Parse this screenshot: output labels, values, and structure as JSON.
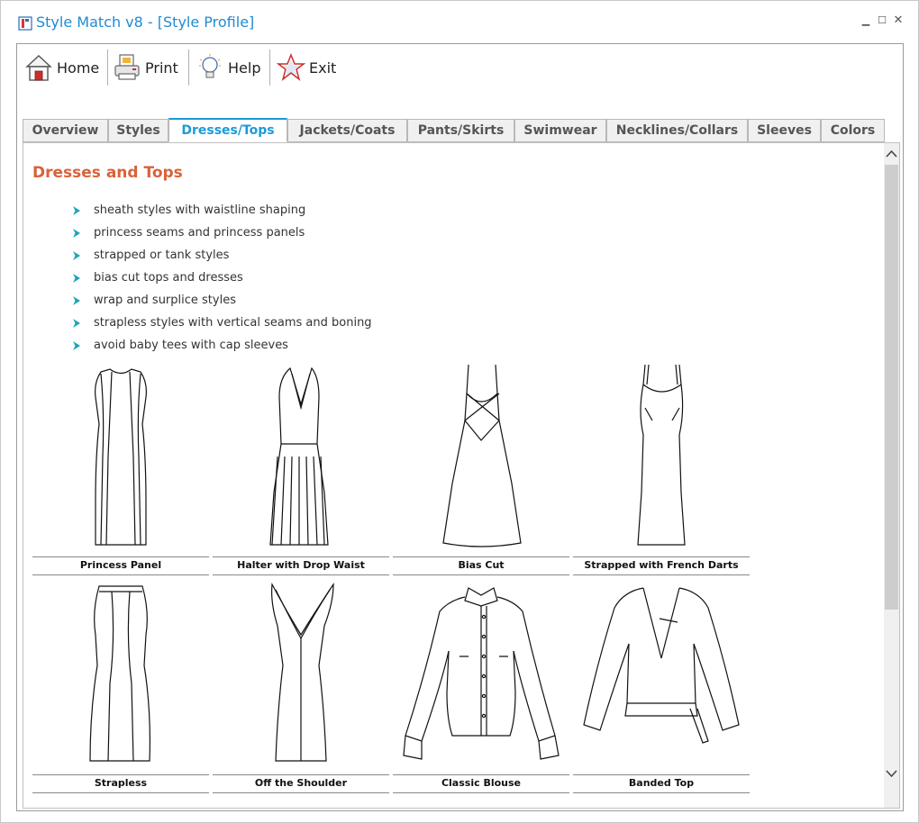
{
  "window": {
    "title": "Style Match v8 - [Style Profile]",
    "controls": {
      "minimize": "▁",
      "maximize": "☐",
      "close": "✕"
    }
  },
  "toolbar": {
    "items": [
      {
        "label": "Home",
        "icon": "home-icon"
      },
      {
        "label": "Print",
        "icon": "printer-icon"
      },
      {
        "label": "Help",
        "icon": "lightbulb-icon"
      },
      {
        "label": "Exit",
        "icon": "star-icon"
      }
    ]
  },
  "tabs": [
    {
      "label": "Overview",
      "active": false
    },
    {
      "label": "Styles",
      "active": false
    },
    {
      "label": "Dresses/Tops",
      "active": true
    },
    {
      "label": "Jackets/Coats",
      "active": false
    },
    {
      "label": "Pants/Skirts",
      "active": false
    },
    {
      "label": "Swimwear",
      "active": false
    },
    {
      "label": "Necklines/Collars",
      "active": false
    },
    {
      "label": "Sleeves",
      "active": false
    },
    {
      "label": "Colors",
      "active": false
    }
  ],
  "section": {
    "title": "Dresses and Tops",
    "bullets": [
      "sheath styles with waistline shaping",
      "princess seams and princess panels",
      "strapped or tank styles",
      "bias cut tops and dresses",
      "wrap and surplice styles",
      "strapless styles with vertical seams and boning",
      "avoid baby tees with cap sleeves"
    ]
  },
  "styles": [
    {
      "caption": "Princess Panel",
      "icon": "princess-panel-dress-icon"
    },
    {
      "caption": "Halter with Drop Waist",
      "icon": "halter-drop-waist-dress-icon"
    },
    {
      "caption": "Bias Cut",
      "icon": "bias-cut-dress-icon"
    },
    {
      "caption": "Strapped with French Darts",
      "icon": "strapped-french-darts-dress-icon"
    },
    {
      "caption": "Strapless",
      "icon": "strapless-dress-icon"
    },
    {
      "caption": "Off the Shoulder",
      "icon": "off-shoulder-dress-icon"
    },
    {
      "caption": "Classic Blouse",
      "icon": "classic-blouse-icon"
    },
    {
      "caption": "Banded Top",
      "icon": "banded-top-icon"
    }
  ],
  "colors": {
    "title": "#1f8bd6",
    "active_tab": "#1b9ad6",
    "section_title": "#d9623b",
    "bullet": "#1aa3b8"
  }
}
